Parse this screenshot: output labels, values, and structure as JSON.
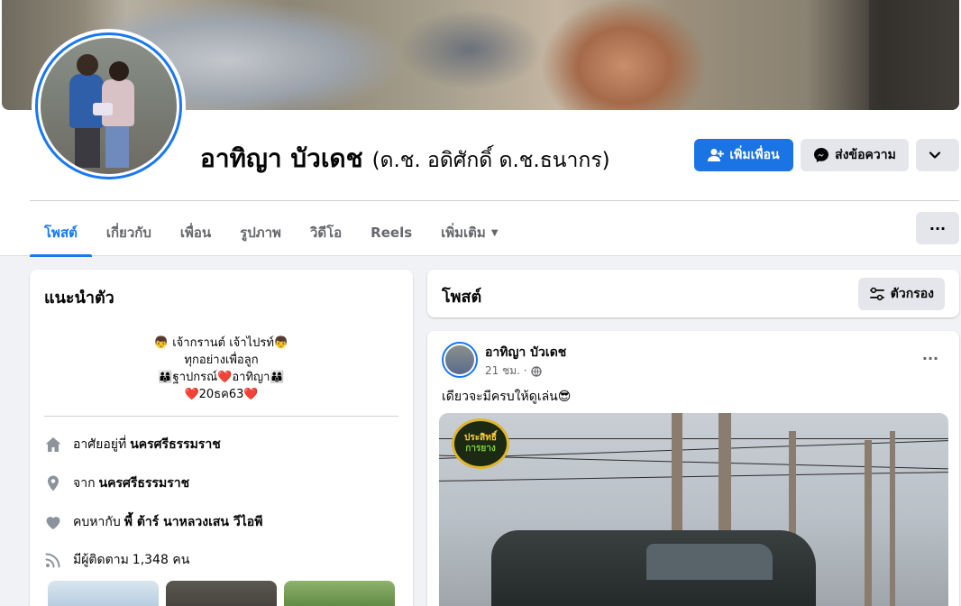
{
  "profile": {
    "name": "อาทิญา บัวเดช",
    "alt_name": "(ด.ช. อดิศักดิ์ ด.ช.ธนากร)"
  },
  "actions": {
    "add_friend": "เพิ่มเพื่อน",
    "message": "ส่งข้อความ",
    "more_icon": "chevron-down-icon"
  },
  "tabs": [
    {
      "label": "โพสต์",
      "active": true
    },
    {
      "label": "เกี่ยวกับ",
      "active": false
    },
    {
      "label": "เพื่อน",
      "active": false
    },
    {
      "label": "รูปภาพ",
      "active": false
    },
    {
      "label": "วิดีโอ",
      "active": false
    },
    {
      "label": "Reels",
      "active": false
    },
    {
      "label": "เพิ่มเติม",
      "active": false
    }
  ],
  "tab_more_label": "···",
  "intro": {
    "title": "แนะนำตัว",
    "bio_lines": [
      "👦 เจ้ากรานต์ เจ้าไปรท์👦",
      "ทุกอย่างเพื่อลูก",
      "👨‍👩‍👦ฐาปกรณ์❤️อาทิญา👨‍👩‍👦",
      "❤️20ธค63❤️"
    ],
    "details": [
      {
        "icon": "home-icon",
        "prefix": "อาศัยอยู่ที่",
        "value": "นครศรีธรรมราช"
      },
      {
        "icon": "location-pin-icon",
        "prefix": "จาก",
        "value": "นครศรีธรรมราช"
      },
      {
        "icon": "heart-icon",
        "prefix": "คบหากับ",
        "value": "พี้ ต้าร์ นาหลวงเสน วีไอพี"
      },
      {
        "icon": "rss-icon",
        "prefix": "มีผู้ติดตาม",
        "value": "1,348 คน"
      }
    ]
  },
  "posts_header": {
    "title": "โพสต์",
    "filter_label": "ตัวกรอง"
  },
  "post": {
    "author": "อาทิญา บัวเดช",
    "time": "21 ชม. ·",
    "text": "เดียวจะมีครบให้ดูเล่น😎",
    "more_label": "···",
    "image_logo_line1": "ประสิทธิ์",
    "image_logo_line2": "การยาง"
  },
  "colors": {
    "accent": "#1877f2",
    "button_primary": "#1b74e4",
    "button_secondary": "#e4e6eb",
    "background": "#f0f2f5"
  }
}
